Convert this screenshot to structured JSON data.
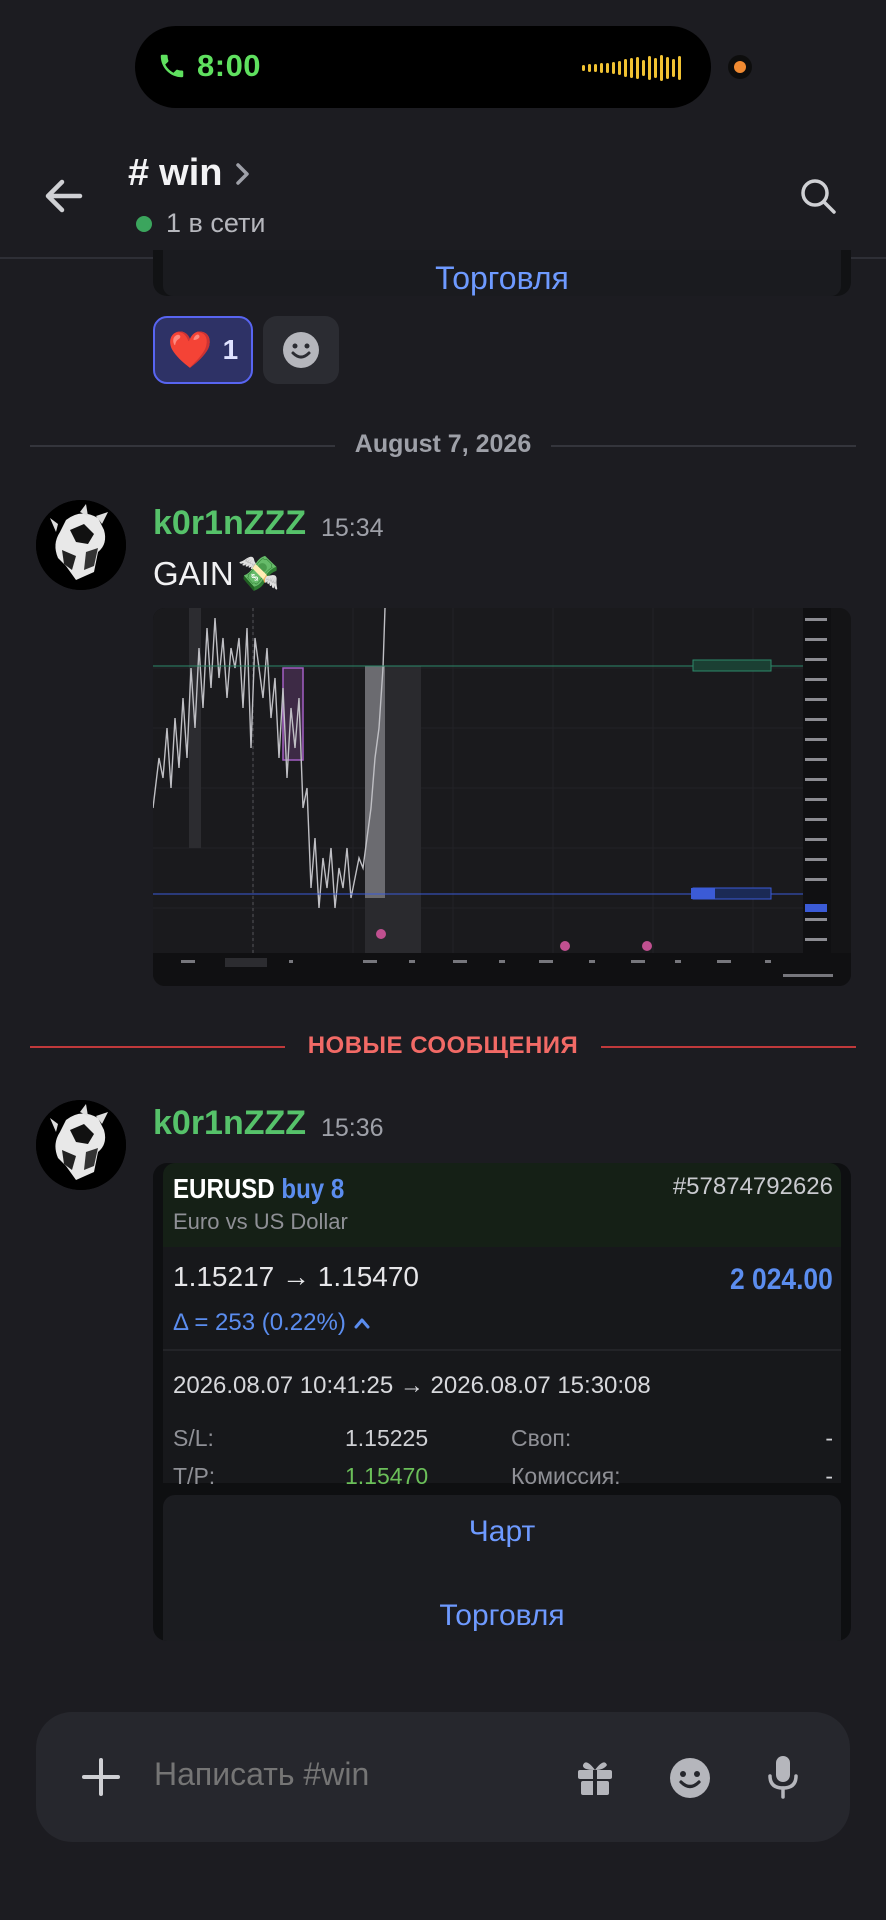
{
  "status": {
    "call_time": "8:00",
    "icons": [
      "phone-icon",
      "audio-wave-icon",
      "camera-dot"
    ]
  },
  "header": {
    "hash": "#",
    "channel_name": "win",
    "online": "1 в сети",
    "icons": [
      "back-arrow-icon",
      "chevron-right-icon",
      "search-icon"
    ]
  },
  "top_card": {
    "button_label": "Торговля"
  },
  "reactions": {
    "heart": {
      "emoji": "❤️",
      "count": "1"
    },
    "add_icon": "add-reaction-icon"
  },
  "date_divider": "August 7, 2026",
  "message1": {
    "author": "k0r1nZZZ",
    "time": "15:34",
    "text": "GAIN",
    "emoji": "💸"
  },
  "new_messages_label": "НОВЫЕ СООБЩЕНИЯ",
  "message2": {
    "author": "k0r1nZZZ",
    "time": "15:36"
  },
  "trade": {
    "symbol": "EURUSD",
    "direction": "buy 8",
    "order_id": "#57874792626",
    "description": "Euro vs US Dollar",
    "prices": "1.15217 → 1.15470",
    "profit": "2 024.00",
    "delta": "Δ = 253 (0.22%)",
    "dates": "2026.08.07 10:41:25 → 2026.08.07 15:30:08",
    "sl_label": "S/L:",
    "sl_value": "1.15225",
    "tp_label": "T/P:",
    "tp_value": "1.15470",
    "swap_label": "Своп:",
    "swap_value": "-",
    "commission_label": "Комиссия:",
    "commission_value": "-",
    "chart_button": "Чарт",
    "trade_button": "Торговля"
  },
  "composer": {
    "placeholder": "Написать #win"
  },
  "colors": {
    "background": "#1c1c21",
    "author": "#56c26a",
    "accent": "#6e9aff",
    "new_messages": "#f26a66",
    "online_dot": "#3ba55d"
  }
}
